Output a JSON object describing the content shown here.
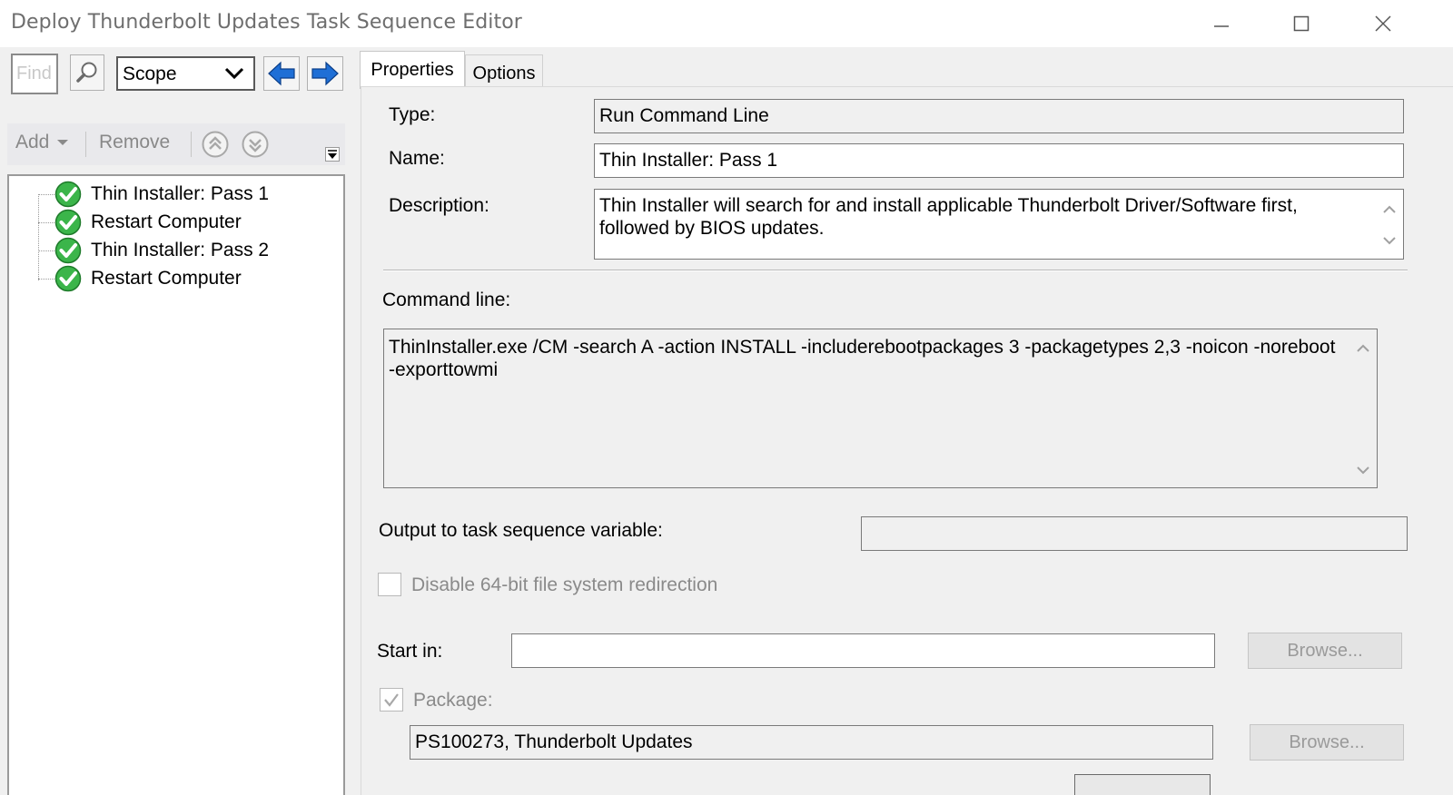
{
  "window": {
    "title": "Deploy Thunderbolt Updates Task Sequence Editor"
  },
  "left": {
    "find_placeholder": "Find",
    "scope_label": "Scope",
    "toolbar": {
      "add_label": "Add",
      "remove_label": "Remove"
    },
    "tree": [
      {
        "label": "Thin Installer: Pass 1",
        "status": "success",
        "selected": true
      },
      {
        "label": "Restart Computer",
        "status": "success"
      },
      {
        "label": "Thin Installer: Pass 2",
        "status": "success"
      },
      {
        "label": "Restart Computer",
        "status": "success"
      }
    ]
  },
  "tabs": [
    {
      "label": "Properties",
      "active": true
    },
    {
      "label": "Options",
      "active": false
    }
  ],
  "properties": {
    "type_label": "Type:",
    "type_value": "Run Command Line",
    "name_label": "Name:",
    "name_value": "Thin Installer: Pass 1",
    "description_label": "Description:",
    "description_value": "Thin Installer will search for and install applicable Thunderbolt Driver/Software first, followed by BIOS updates.",
    "command_line_label": "Command line:",
    "command_line_value": "ThinInstaller.exe /CM -search A -action INSTALL -includerebootpackages 3 -packagetypes 2,3 -noicon -noreboot -exporttowmi",
    "output_variable_label": "Output to task sequence variable:",
    "output_variable_value": "",
    "disable_redirection_label": "Disable 64-bit file system redirection",
    "disable_redirection_checked": false,
    "start_in_label": "Start in:",
    "start_in_value": "",
    "browse_label": "Browse...",
    "package_label": "Package:",
    "package_checked": true,
    "package_value": "PS100273, Thunderbolt Updates"
  },
  "colors": {
    "success_green": "#3bb54a",
    "arrow_blue": "#1f6fd6",
    "title_text": "#6e6e6e"
  }
}
